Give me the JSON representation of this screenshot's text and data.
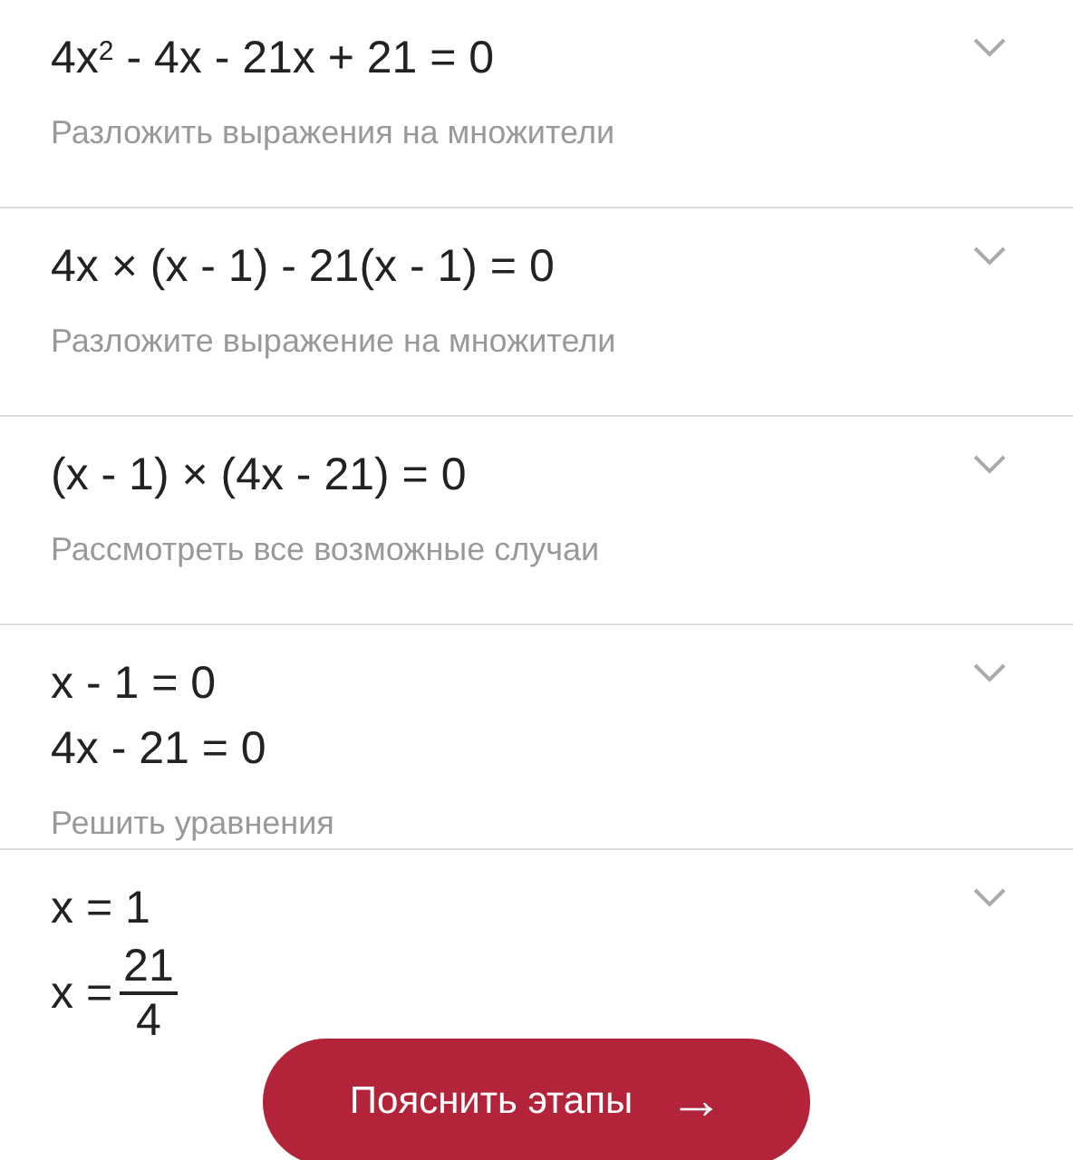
{
  "steps": [
    {
      "lines": [
        {
          "kind": "text",
          "text": "4x$^{2}$ - 4x - 21x + 21 = 0"
        }
      ],
      "description": "Разложить выражения на множители",
      "expanded": false
    },
    {
      "lines": [
        {
          "kind": "text",
          "text": "4x × (x - 1) - 21(x - 1) = 0"
        }
      ],
      "description": "Разложите выражение на множители",
      "expanded": false
    },
    {
      "lines": [
        {
          "kind": "text",
          "text": "(x - 1) × (4x - 21) = 0"
        }
      ],
      "description": "Рассмотреть все возможные случаи",
      "expanded": false
    },
    {
      "lines": [
        {
          "kind": "text",
          "text": "x - 1 = 0"
        },
        {
          "kind": "text",
          "text": "4x - 21 = 0"
        }
      ],
      "description": "Решить уравнения",
      "expanded": false
    },
    {
      "lines": [
        {
          "kind": "text",
          "text": "x = 1"
        },
        {
          "kind": "fraction",
          "lhs": "x =",
          "numerator": "21",
          "denominator": "4"
        }
      ],
      "expanded": false
    }
  ],
  "explain_button": {
    "label": "Пояснить этапы",
    "icon": "→"
  }
}
